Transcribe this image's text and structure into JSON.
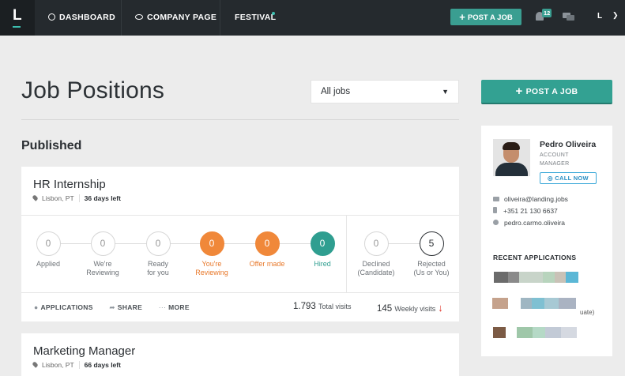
{
  "nav": {
    "logo": "L",
    "dashboard": "DASHBOARD",
    "company_page": "COMPANY PAGE",
    "festival": "FESTIVAL",
    "post_job": "POST A JOB",
    "notifications_count": "12",
    "avatar_initial": "L",
    "accent": "#3a9e91"
  },
  "main": {
    "title": "Job Positions",
    "filter_selected": "All jobs",
    "section": "Published"
  },
  "jobs": [
    {
      "title": "HR Internship",
      "location": "Lisbon, PT",
      "days_left": "36 days left",
      "stages": [
        {
          "count": "0",
          "label": "Applied"
        },
        {
          "count": "0",
          "label": "We're Reviewing"
        },
        {
          "count": "0",
          "label": "Ready for you"
        },
        {
          "count": "0",
          "label": "You're Reviewing"
        },
        {
          "count": "0",
          "label": "Offer made"
        },
        {
          "count": "0",
          "label": "Hired"
        },
        {
          "count": "0",
          "label": "Declined (Candidate)"
        },
        {
          "count": "5",
          "label": "Rejected (Us or You)"
        }
      ],
      "actions": {
        "applications": "APPLICATIONS",
        "share": "SHARE",
        "more": "MORE"
      },
      "total_visits": "1.793",
      "total_visits_label": "Total visits",
      "weekly_visits": "145",
      "weekly_visits_label": "Weekly visits"
    },
    {
      "title": "Marketing Manager",
      "location": "Lisbon, PT",
      "days_left": "66 days left"
    }
  ],
  "sidebar": {
    "post_job": "POST A JOB",
    "manager_name": "Pedro Oliveira",
    "manager_role": "ACCOUNT MANAGER",
    "call_now": "CALL NOW",
    "email": "oliveira@landing.jobs",
    "phone": "+351 21 130 6637",
    "skype": "pedro.carmo.oliveira",
    "recent_title": "RECENT APPLICATIONS",
    "recent_fragment": "uate)"
  }
}
